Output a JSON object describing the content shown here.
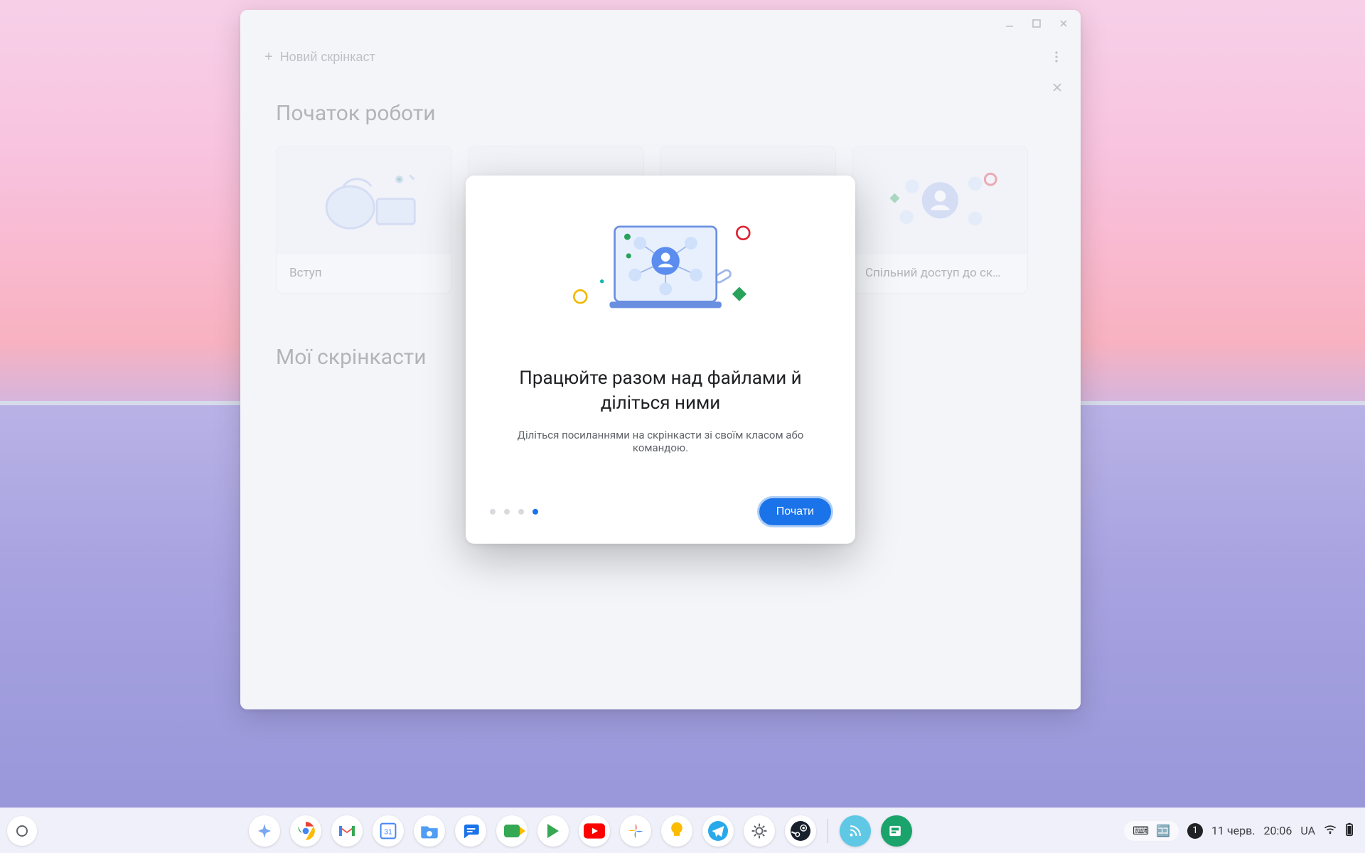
{
  "window": {
    "new_button": "Новий скрінкаст",
    "getting_started_title": "Початок роботи",
    "my_screencasts_title": "Мої скрінкасти",
    "cards": [
      {
        "label": "Вступ"
      },
      {
        "label": ""
      },
      {
        "label": ""
      },
      {
        "label": "Спільний доступ до ск…"
      }
    ]
  },
  "modal": {
    "title": "Працюйте разом над файлами й діліться ними",
    "subtitle": "Діліться посиланнями на скрінкасти зі своїм класом або командою.",
    "primary": "Почати",
    "step_index": 4,
    "step_total": 4
  },
  "shelf": {
    "apps": [
      "assistant",
      "chrome",
      "gmail",
      "calendar",
      "files",
      "messages",
      "camera",
      "play-store",
      "youtube",
      "photos",
      "keep",
      "telegram",
      "settings",
      "steam",
      "screencast",
      "projector"
    ],
    "date": "11 черв.",
    "time": "20:06",
    "locale": "UA",
    "notifications": "1"
  }
}
